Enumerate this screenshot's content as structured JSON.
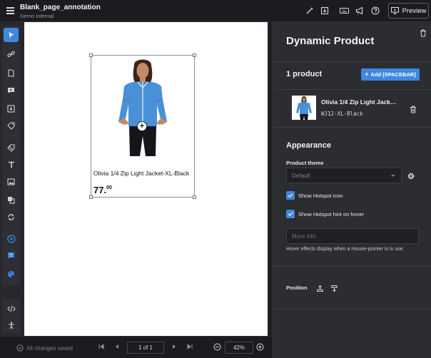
{
  "header": {
    "title": "Blank_page_annotation",
    "subtitle": "Demo Internal",
    "preview_label": "Preview",
    "icons": [
      "magic-wand-icon",
      "download-icon",
      "keyboard-icon",
      "megaphone-icon",
      "help-icon",
      "monitor-icon"
    ]
  },
  "toolbar": {
    "tools": [
      "select-tool",
      "link-tool",
      "page-tool",
      "video-tool",
      "download-tool",
      "tag-tool",
      "eraser-tool",
      "text-tool",
      "image-tool",
      "layers-tool",
      "sync-tool",
      "add-tool",
      "alert-tool",
      "palette-tool",
      "code-tool",
      "accessibility-tool"
    ]
  },
  "canvas": {
    "product_name": "Olivia 1/4 Zip Light Jacket-XL-Black",
    "price_main": "77.",
    "price_cents": "00",
    "hotspot_symbol": "+"
  },
  "footer": {
    "saved_status": "All changes saved",
    "page_indicator": "1 of 1",
    "zoom": "42%"
  },
  "panel": {
    "title": "Dynamic Product",
    "product_count": "1 product",
    "add_button": "Add [SPACEBAR]",
    "item": {
      "name": "Olivia 1/4 Zip Light Jack…",
      "sku": "WJ12-XL-Black"
    },
    "appearance": {
      "title": "Appearance",
      "theme_label": "Product theme",
      "theme_value": "Default",
      "show_hotspot_icon": "Show Hotspot icon",
      "show_hotspot_hint": "Show Hotspot hint on hover",
      "more_info_placeholder": "More info",
      "hint_text": "Hover effects display when a mouse-pointer is in use."
    },
    "position_label": "Position"
  },
  "colors": {
    "accent": "#3f87e0",
    "panel_bg": "#2b2d31",
    "jacket": "#4a90d9"
  }
}
